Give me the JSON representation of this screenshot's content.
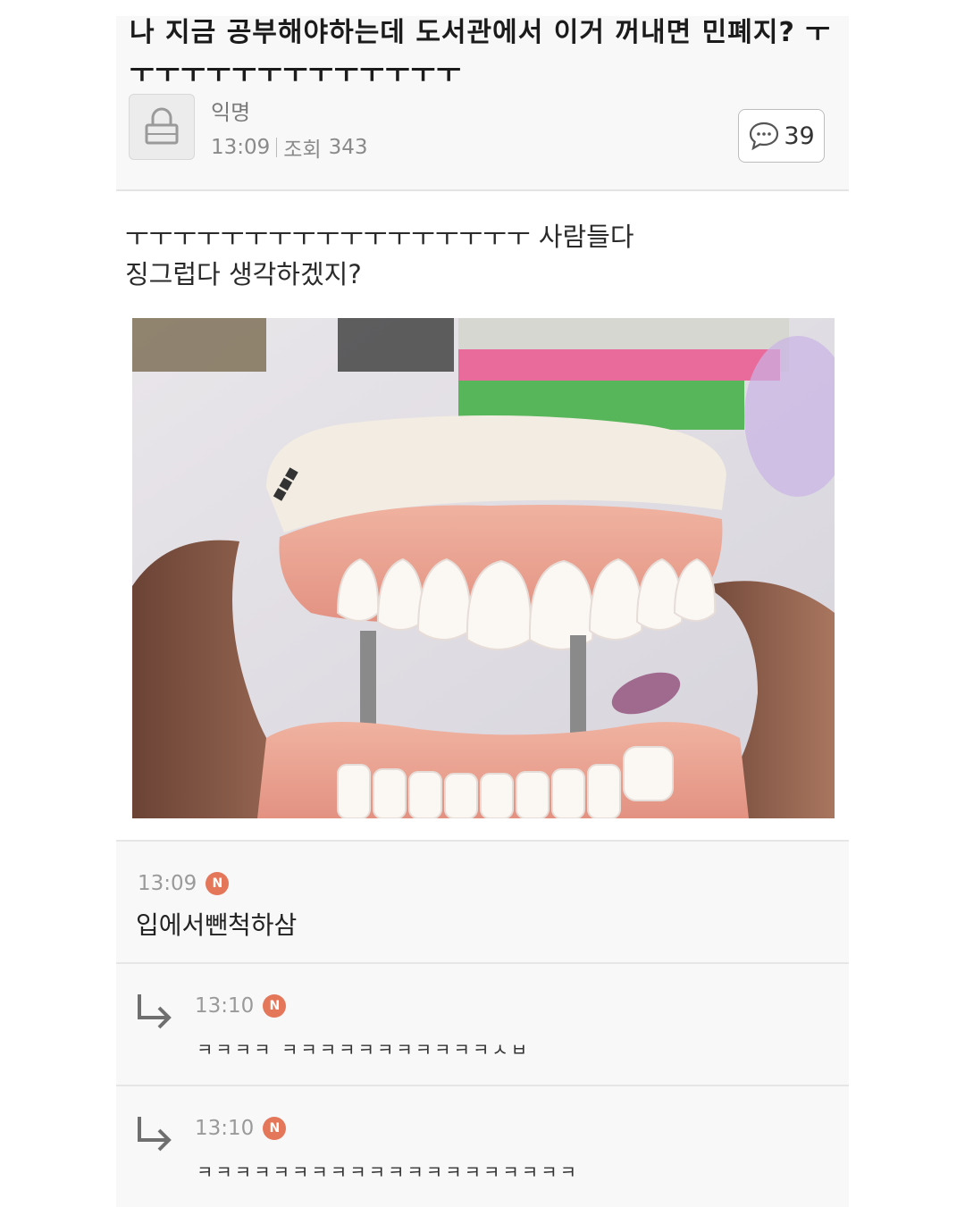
{
  "post": {
    "title": "나 지금 공부해야하는데 도서관에서 이거 꺼내면 민폐지? ㅜㅜㅜㅜㅜㅜㅜㅜㅜㅜㅜㅜㅜㅜ",
    "author": "익명",
    "time": "13:09",
    "views_label": "조회",
    "views": "343",
    "comment_count": "39",
    "body_line1": "ㅜㅜㅜㅜㅜㅜㅜㅜㅜㅜㅜㅜㅜㅜㅜㅜㅜ 사람들다",
    "body_line2": "징그럽다 생각하겠지?",
    "image_icon": "dental-model-photo"
  },
  "comments": [
    {
      "time": "13:09",
      "badge": "N",
      "text": "입에서뺀척하삼"
    },
    {
      "time": "13:10",
      "badge": "N",
      "text": "ㅋㅋㅋㅋ ㅋㅋㅋㅋㅋㅋㅋㅋㅋㅋㅋㅅㅂ"
    },
    {
      "time": "13:10",
      "badge": "N",
      "text": "ㅋㅋㅋㅋㅋㅋㅋㅋㅋㅋㅋㅋㅋㅋㅋㅋㅋㅋㅋㅋ"
    }
  ],
  "colors": {
    "badge": "#e4765a",
    "header_bg": "#f8f8f8",
    "text": "#222222"
  },
  "icons": {
    "avatar": "lock-icon",
    "comments": "speech-bubble-icon",
    "reply": "reply-arrow-icon"
  }
}
